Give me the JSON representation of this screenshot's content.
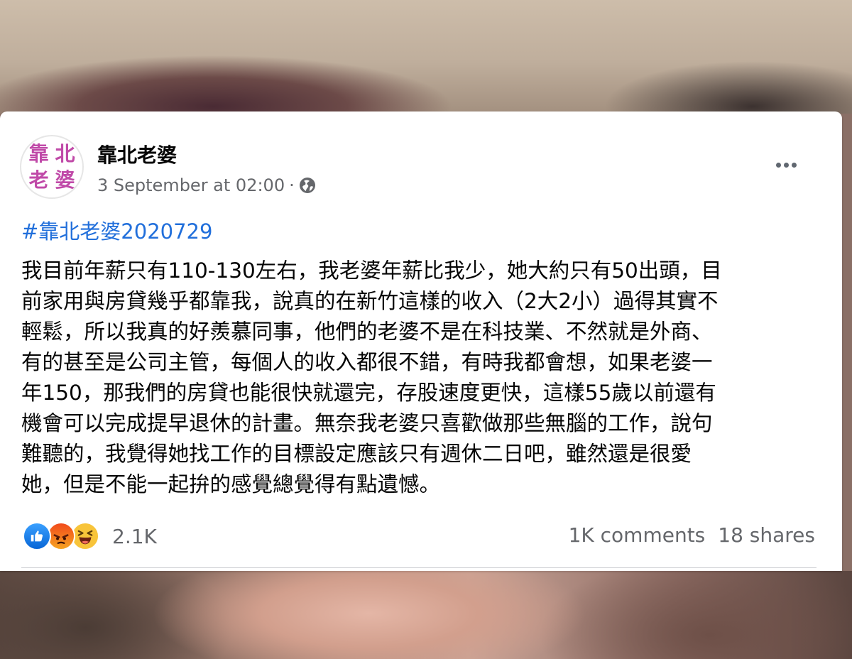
{
  "post": {
    "page_name": "靠北老婆",
    "timestamp": "3 September at 02:00",
    "separator": "·",
    "hashtag": "#靠北老婆2020729",
    "body": "我目前年薪只有110-130左右，我老婆年薪比我少，她大約只有50出頭，目\n前家用與房貸幾乎都靠我，說真的在新竹這樣的收入（2大2小）過得其實不\n輕鬆，所以我真的好羨慕同事，他們的老婆不是在科技業、不然就是外商、\n有的甚至是公司主管，每個人的收入都很不錯，有時我都會想，如果老婆一\n年150，那我們的房貸也能很快就還完，存股速度更快，這樣55歲以前還有\n機會可以完成提早退休的計畫。無奈我老婆只喜歡做那些無腦的工作，說句\n難聽的，我覺得她找工作的目標設定應該只有週休二日吧，雖然還是很愛\n她，但是不能一起拚的感覺總覺得有點遺憾。",
    "avatar_text": [
      "靠",
      "北",
      "老",
      "婆"
    ],
    "privacy_icon": "globe-icon",
    "more_icon": "more-options-icon"
  },
  "footer": {
    "reactions": [
      "like-icon",
      "angry-icon",
      "haha-icon"
    ],
    "reaction_count": "2.1K",
    "comments": "1K comments",
    "shares": "18 shares"
  },
  "colors": {
    "link": "#216fdb",
    "secondary_text": "#65676b",
    "avatar_accent": "#c04aa8"
  }
}
